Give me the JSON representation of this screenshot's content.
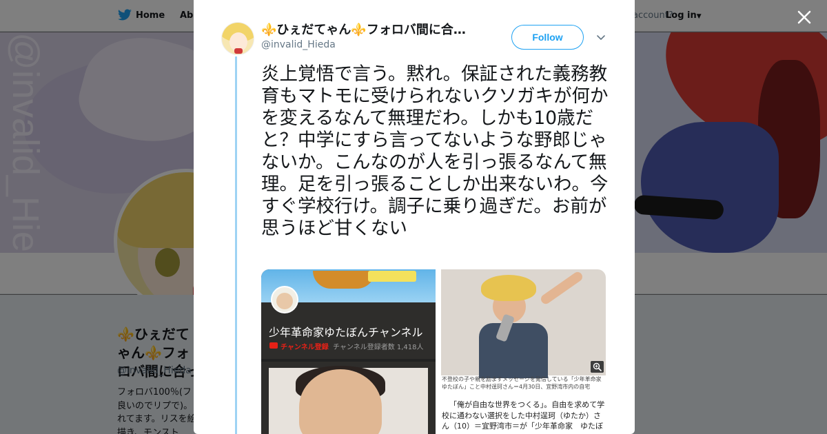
{
  "nav": {
    "home": "Home",
    "about": "Abo",
    "have_account": "account?",
    "login": "Log in"
  },
  "banner": {
    "watermark": "@invalid_Hieda"
  },
  "background_profile": {
    "name": "⚜️ひぇだてゃん⚜️フォロバ間に合っ",
    "handle": "@invalid_Hieda",
    "bio": "フォロバ100％(フ良いのでリプで)。れてます。リスを絵描き、モンスト"
  },
  "tweet": {
    "author": {
      "display_name": "⚜️ひぇだてゃん⚜️フォロバ間に合…",
      "screen_name": "@invalid_Hieda"
    },
    "follow_label": "Follow",
    "text": "炎上覚悟で言う。黙れ。保証された義務教育もマトモに受けられないクソガキが何かを変えるなんて無理だわ。しかも10歳だと？中学にすら言ってないような野郎じゃないか。こんなのが人を引っ張るなんて無理。足を引っ張ることしか出来ないわ。今すぐ学校行け。調子に乗り過ぎだ。お前が思うほど甘くない"
  },
  "media": {
    "left": {
      "channel_name": "少年革命家ゆたぼんチャンネル",
      "subscribe_label": "チャンネル登録",
      "subscriber_count": "チャンネル登録者数 1,418人"
    },
    "right": {
      "caption": "不登校の子や親を励ますメッセージを発信している「少年革命家ゆたぼん」こと中村逞珂さん＝4月30日、宜野湾市内の自宅",
      "article": "「俺が自由な世界をつくる」。自由を求めて学校に通わない選択をした中村逞珂（ゆたか）さん（10）＝宜野湾市＝が「少年革命家　ゆたぼ"
    }
  },
  "icons": {
    "close": "close-icon",
    "caret": "chevron-down-icon",
    "zoom": "zoom-icon",
    "bird": "twitter-bird-icon"
  },
  "colors": {
    "accent": "#1da1f2",
    "thread_line": "#9ed3f4",
    "overlay": "rgba(0,0,0,0.5)"
  }
}
